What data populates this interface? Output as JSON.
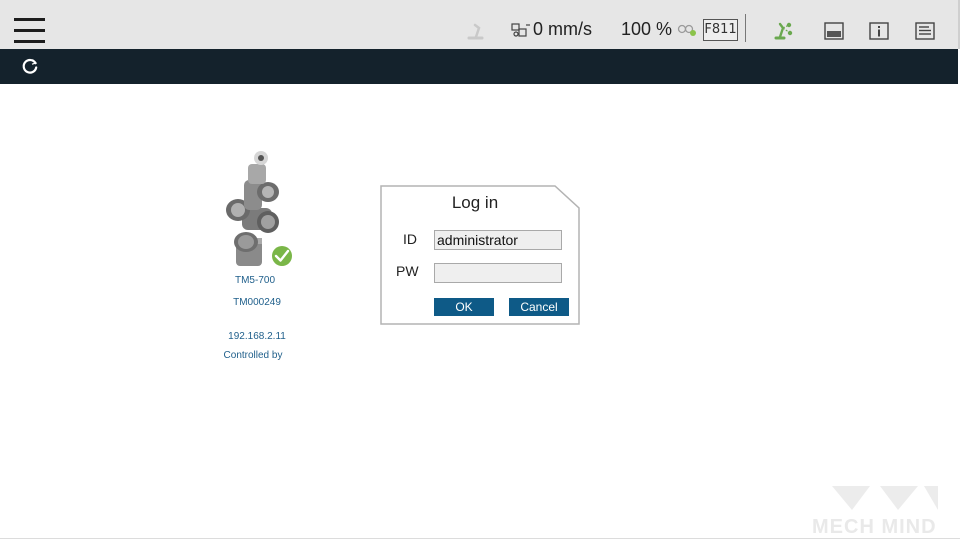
{
  "toolbar": {
    "speed": "0 mm/s",
    "percent": "100 %",
    "function_badge": "F811"
  },
  "robot": {
    "model": "TM5-700",
    "serial": "TM000249",
    "ip": "192.168.2.11",
    "controlled_by": "Controlled by"
  },
  "login": {
    "title": "Log in",
    "id_label": "ID",
    "pw_label": "PW",
    "id_value": "administrator",
    "pw_value": "",
    "ok_label": "OK",
    "cancel_label": "Cancel"
  },
  "watermark": {
    "text": "MECH MIND"
  },
  "colors": {
    "toolbar_bg": "#e6e6e6",
    "darkbar_bg": "#14222c",
    "button_bg": "#0e5a87",
    "link_text": "#1f5f8b",
    "status_green": "#7ab648"
  }
}
